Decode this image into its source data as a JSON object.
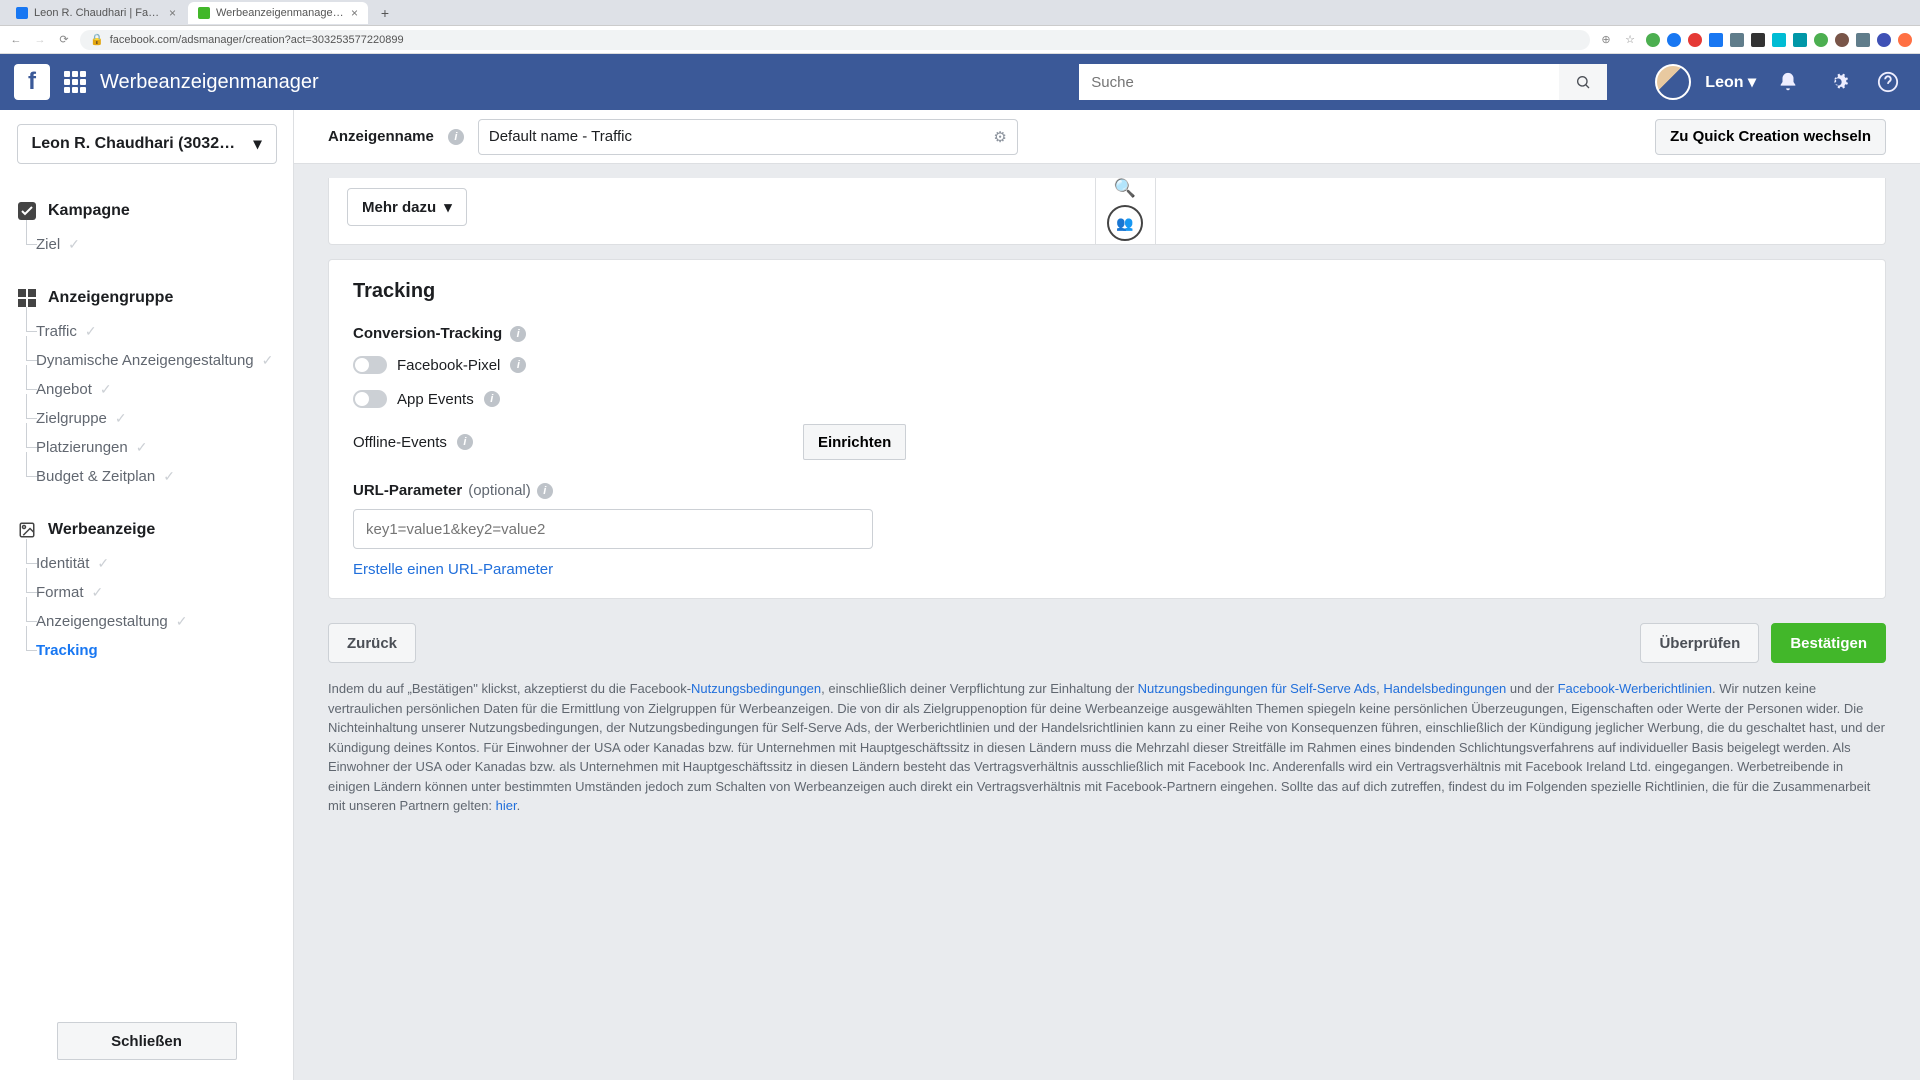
{
  "browser": {
    "tabs": [
      {
        "label": "Leon R. Chaudhari | Facebook",
        "favicon_color": "#1877f2"
      },
      {
        "label": "Werbeanzeigenmanager - Cre…",
        "favicon_color": "#42b72a"
      }
    ],
    "new_tab": "+",
    "url": "facebook.com/adsmanager/creation?act=303253577220899",
    "ext_colors": [
      "#bdbdbd",
      "#f5b400",
      "#4caf50",
      "#1877f2",
      "#e53935",
      "#1877f2",
      "#607d8b",
      "#333",
      "#00bcd4",
      "#0097a7",
      "#4caf50",
      "#795548",
      "#607d8b",
      "#3f51b5",
      "#1565c0",
      "#ff7043"
    ]
  },
  "header": {
    "title": "Werbeanzeigenmanager",
    "search_placeholder": "Suche",
    "user": "Leon"
  },
  "sidebar": {
    "account": "Leon R. Chaudhari (3032…",
    "campaign": "Kampagne",
    "campaign_items": [
      "Ziel"
    ],
    "adset": "Anzeigengruppe",
    "adset_items": [
      "Traffic",
      "Dynamische Anzeigengestaltung",
      "Angebot",
      "Zielgruppe",
      "Platzierungen",
      "Budget & Zeitplan"
    ],
    "ad": "Werbeanzeige",
    "ad_items": [
      "Identität",
      "Format",
      "Anzeigengestaltung",
      "Tracking"
    ],
    "close": "Schließen"
  },
  "top": {
    "name_label": "Anzeigenname",
    "name_value": "Default name - Traffic",
    "quick": "Zu Quick Creation wechseln"
  },
  "cta": {
    "more": "Mehr dazu"
  },
  "tracking": {
    "title": "Tracking",
    "conversion": "Conversion-Tracking",
    "pixel": "Facebook-Pixel",
    "app_events": "App Events",
    "offline": "Offline-Events",
    "setup": "Einrichten",
    "url_param": "URL-Parameter",
    "optional": "(optional)",
    "url_placeholder": "key1=value1&key2=value2",
    "url_link": "Erstelle einen URL-Parameter"
  },
  "footer": {
    "back": "Zurück",
    "review": "Überprüfen",
    "confirm": "Bestätigen"
  },
  "legal": {
    "p1a": "Indem du auf „Bestätigen\" klickst, akzeptierst du die Facebook-",
    "tos": "Nutzungsbedingungen",
    "p1b": ", einschließlich deiner Verpflichtung zur Einhaltung der ",
    "selfserve": "Nutzungsbedingungen für Self-Serve Ads",
    "p1c": ", ",
    "commercial": "Handelsbedingungen",
    "p1d": " und der ",
    "adpol": "Facebook-Werberichtlinien",
    "p1e": ". Wir nutzen keine vertraulichen persönlichen Daten für die Ermittlung von Zielgruppen für Werbeanzeigen. Die von dir als Zielgruppenoption für deine Werbeanzeige ausgewählten Themen spiegeln keine persönlichen Überzeugungen, Eigenschaften oder Werte der Personen wider. Die Nichteinhaltung unserer Nutzungsbedingungen, der Nutzungsbedingungen für Self-Serve Ads, der Werberichtlinien und der Handelsrichtlinien kann zu einer Reihe von Konsequenzen führen, einschließlich der Kündigung jeglicher Werbung, die du geschaltet hast, und der Kündigung deines Kontos. Für Einwohner der USA oder Kanadas bzw. für Unternehmen mit Hauptgeschäftssitz in diesen Ländern muss die Mehrzahl dieser Streitfälle im Rahmen eines bindenden Schlichtungsverfahrens auf individueller Basis beigelegt werden. Als Einwohner der USA oder Kanadas bzw. als Unternehmen mit Hauptgeschäftssitz in diesen Ländern besteht das Vertragsverhältnis ausschließlich mit Facebook Inc. Anderenfalls wird ein Vertragsverhältnis mit Facebook Ireland Ltd. eingegangen. Werbetreibende in einigen Ländern können unter bestimmten Umständen jedoch zum Schalten von Werbeanzeigen auch direkt ein Vertragsverhältnis mit Facebook-Partnern eingehen. Sollte das auf dich zutreffen, findest du im Folgenden spezielle Richtlinien, die für die Zusammenarbeit mit unseren Partnern gelten: ",
    "here": "hier",
    "p1f": "."
  }
}
